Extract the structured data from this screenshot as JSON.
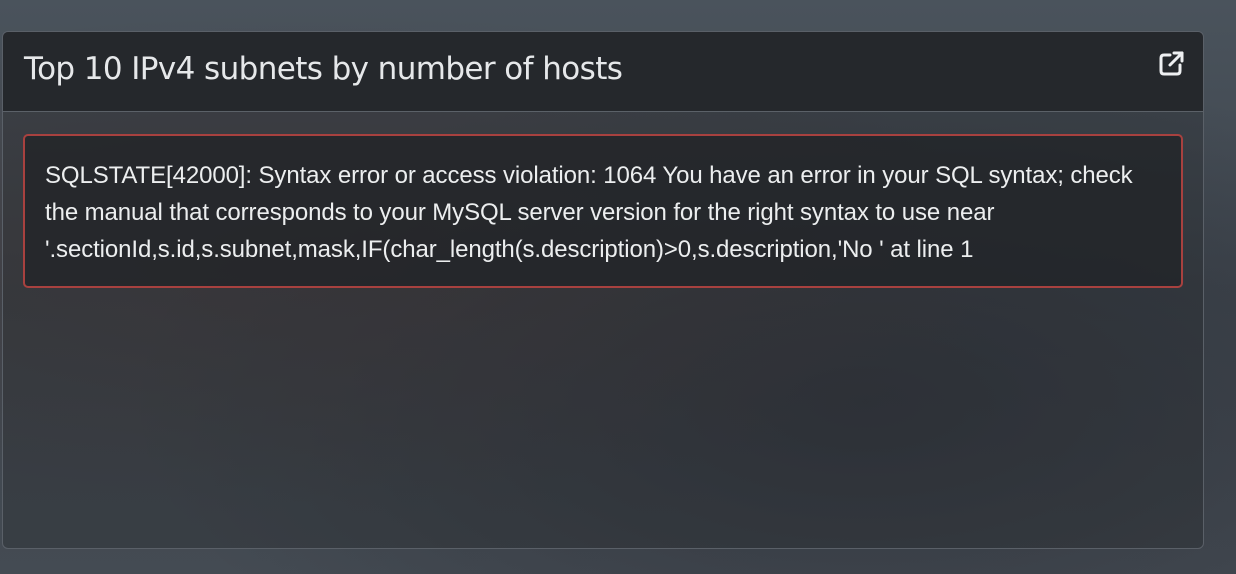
{
  "widget": {
    "title": "Top 10 IPv4 subnets by number of hosts",
    "external_link_icon": "external-link-icon"
  },
  "error": {
    "message": "SQLSTATE[42000]: Syntax error or access violation: 1064 You have an error in your SQL syntax; check the manual that corresponds to your MySQL server version for the right syntax to use near '.sectionId,s.id,s.subnet,mask,IF(char_length(s.description)>0,s.description,'No ' at line 1"
  },
  "colors": {
    "alert_border": "#a8413f",
    "header_bg": "#25282c",
    "text": "#eceeef"
  }
}
